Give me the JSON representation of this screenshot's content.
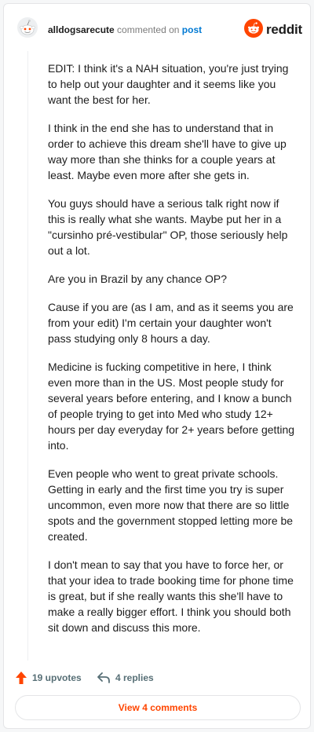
{
  "header": {
    "username": "alldogsarecute",
    "action_text": "commented on",
    "target_link": "post",
    "brand_name": "reddit"
  },
  "comment": {
    "paragraphs": [
      "EDIT: I think it's a NAH situation, you're just trying to help out your daughter and it seems like you want the best for her.",
      "I think in the end she has to understand that in order to achieve this dream she'll have to give up way more than she thinks for a couple years at least. Maybe even more after she gets in.",
      "You guys should have a serious talk right now if this is really what she wants. Maybe put her in a \"cursinho pré-vestibular\" OP, those seriously help out a lot.",
      "Are you in Brazil by any chance OP?",
      "Cause if you are (as I am, and as it seems you are from your edit) I'm certain your daughter won't pass studying only 8 hours a day.",
      "Medicine is fucking competitive in here, I think even more than in the US. Most people study for several years before entering, and I know a bunch of people trying to get into Med who study 12+ hours per day everyday for 2+ years before getting into.",
      "Even people who went to great private schools. Getting in early and the first time you try is super uncommon, even more now that there are so little spots and the government stopped letting more be created.",
      "I don't mean to say that you have to force her, or that your idea to trade booking time for phone time is great, but if she really wants this she'll have to make a really bigger effort. I think you should both sit down and discuss this more."
    ]
  },
  "actions": {
    "upvotes_label": "19 upvotes",
    "replies_label": "4 replies",
    "view_comments_label": "View 4 comments"
  },
  "icons": {
    "avatar": "snoo-avatar-icon",
    "brand": "reddit-logo-icon",
    "upvote": "upvote-arrow-icon",
    "reply": "reply-arrow-icon"
  },
  "colors": {
    "brand_orange": "#ff4500",
    "link_blue": "#0079d3",
    "muted_text": "#576f76"
  }
}
